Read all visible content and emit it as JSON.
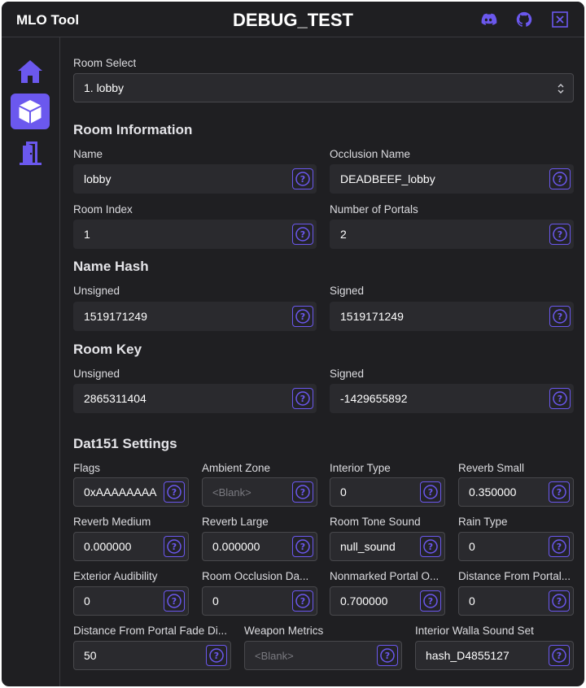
{
  "app": {
    "name": "MLO Tool",
    "title": "DEBUG_TEST"
  },
  "titlebar_icons": [
    "discord-icon",
    "github-icon",
    "close-icon"
  ],
  "sidebar": {
    "items": [
      "home",
      "rooms",
      "portals"
    ],
    "active": "rooms"
  },
  "room_select": {
    "label": "Room Select",
    "value": "1. lobby"
  },
  "room_info": {
    "heading": "Room Information",
    "name_label": "Name",
    "name_value": "lobby",
    "occlusion_label": "Occlusion Name",
    "occlusion_value": "DEADBEEF_lobby",
    "index_label": "Room Index",
    "index_value": "1",
    "portals_label": "Number of Portals",
    "portals_value": "2"
  },
  "name_hash": {
    "heading": "Name Hash",
    "unsigned_label": "Unsigned",
    "unsigned_value": "1519171249",
    "signed_label": "Signed",
    "signed_value": "1519171249"
  },
  "room_key": {
    "heading": "Room Key",
    "unsigned_label": "Unsigned",
    "unsigned_value": "2865311404",
    "signed_label": "Signed",
    "signed_value": "-1429655892"
  },
  "dat151": {
    "heading": "Dat151 Settings",
    "flags_label": "Flags",
    "flags_value": "0xAAAAAAAA",
    "ambient_label": "Ambient Zone",
    "ambient_placeholder": "<Blank>",
    "interior_label": "Interior Type",
    "interior_value": "0",
    "reverb_small_label": "Reverb Small",
    "reverb_small_value": "0.350000",
    "reverb_medium_label": "Reverb Medium",
    "reverb_medium_value": "0.000000",
    "reverb_large_label": "Reverb Large",
    "reverb_large_value": "0.000000",
    "tone_label": "Room Tone Sound",
    "tone_value": "null_sound",
    "rain_label": "Rain Type",
    "rain_value": "0",
    "exterior_label": "Exterior Audibility",
    "exterior_value": "0",
    "occlusion_damp_label": "Room Occlusion Da...",
    "occlusion_damp_value": "0",
    "nonmarked_label": "Nonmarked Portal O...",
    "nonmarked_value": "0.700000",
    "distance_label": "Distance From Portal...",
    "distance_value": "0",
    "fade_label": "Distance From Portal Fade Di...",
    "fade_value": "50",
    "weapon_label": "Weapon Metrics",
    "weapon_placeholder": "<Blank>",
    "walla_label": "Interior Walla Sound Set",
    "walla_value": "hash_D4855127"
  },
  "colors": {
    "accent": "#6b58ee",
    "background": "#1f1f22",
    "field": "#2a2a2e",
    "border": "#3a3a3e"
  }
}
